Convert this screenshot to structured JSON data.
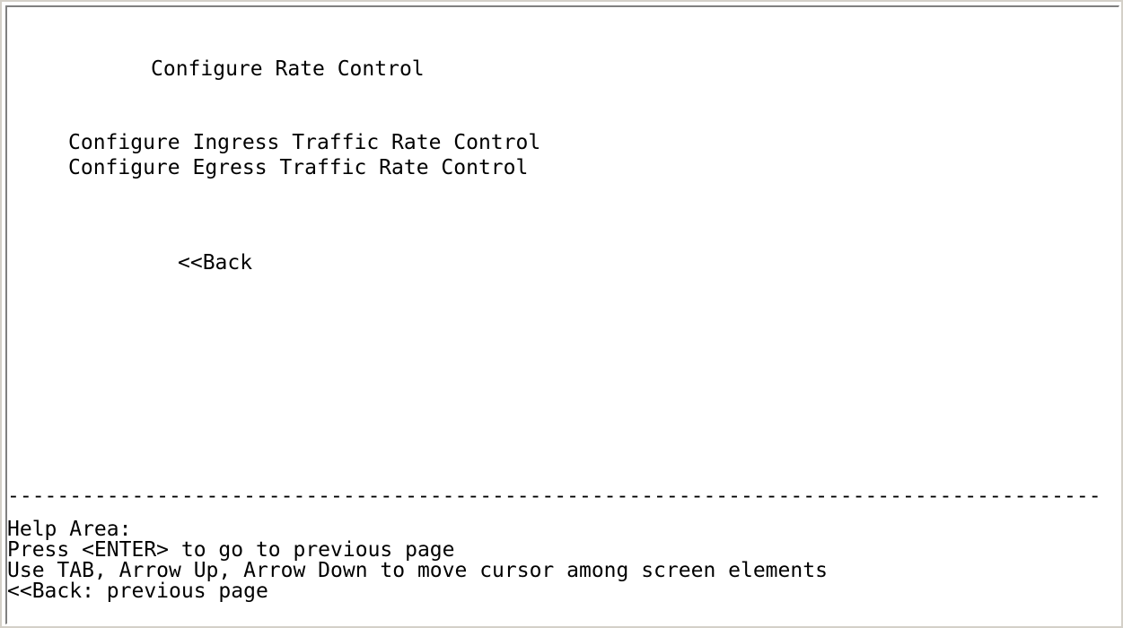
{
  "screen": {
    "title": "Configure Rate Control",
    "menu_items": [
      {
        "label": "Configure Ingress Traffic Rate Control"
      },
      {
        "label": "Configure Egress Traffic Rate Control"
      }
    ],
    "back_label": "<<Back"
  },
  "separator": "-----------------------------------------------------------------------------------------------------------",
  "help": {
    "title": "Help Area:",
    "lines": [
      "Press <ENTER> to go to previous page",
      "Use TAB, Arrow Up, Arrow Down to move cursor among screen elements",
      "<<Back: previous page"
    ]
  }
}
